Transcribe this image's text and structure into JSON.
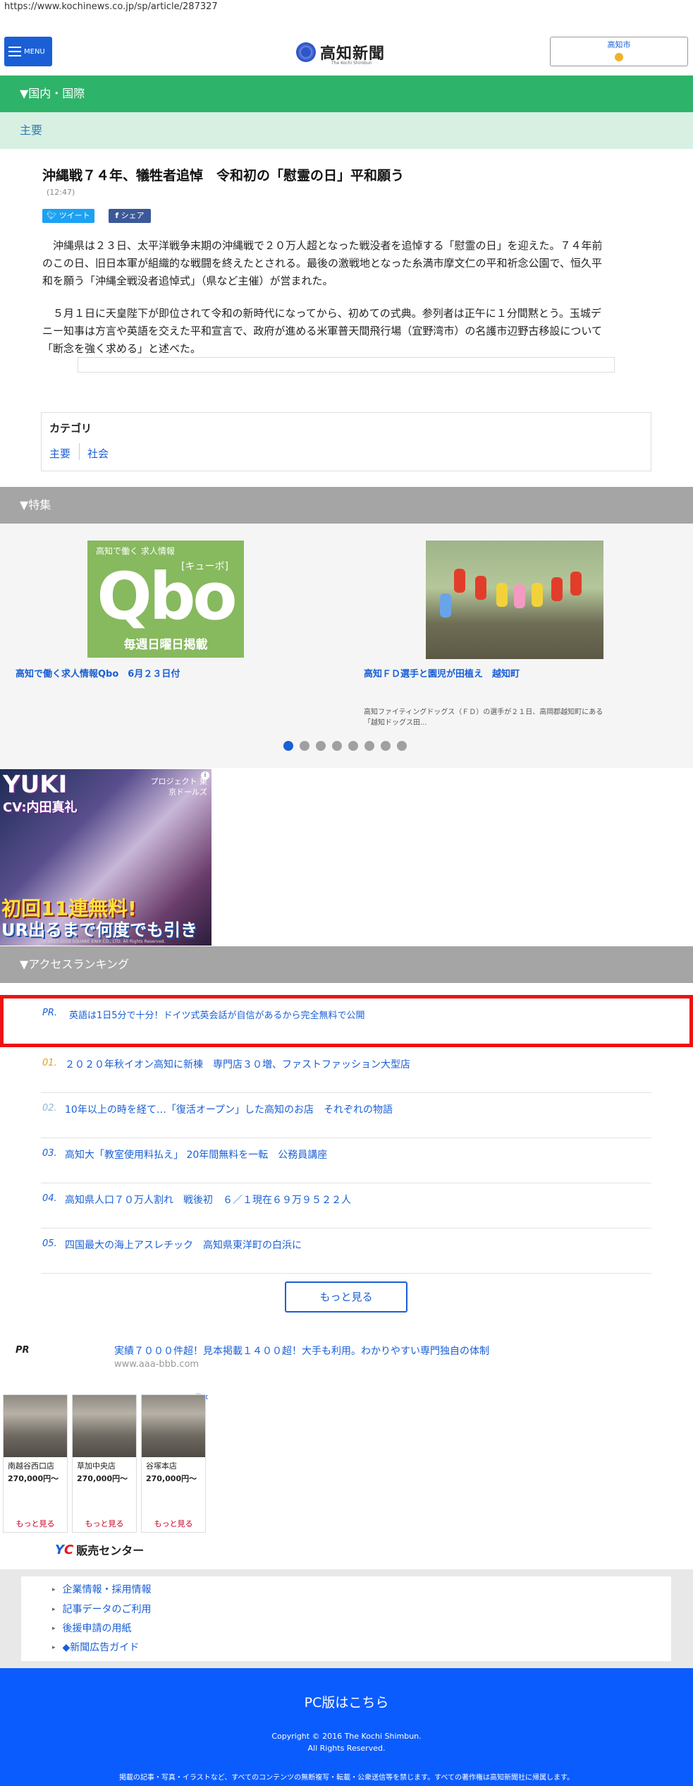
{
  "browser": {
    "url": "https://www.kochinews.co.jp/sp/article/287327"
  },
  "header": {
    "menu_label": "MENU",
    "logo_text": "高知新聞",
    "logo_sub": "The Kochi Shimbun",
    "weather_label": "高知市"
  },
  "section": {
    "title": "▼国内・国際",
    "sub": "主要"
  },
  "article": {
    "headline": "沖縄戦７４年、犠牲者追悼　令和初の「慰霊の日」平和願う",
    "time": "(12:47)",
    "tweet_label": "ツイート",
    "share_label": "シェア",
    "para1_line1": "沖縄県は２３日、太平洋戦争末期の沖縄戦で２０万人超となった戦没者を追悼する「慰霊の日」を迎えた。７４年前",
    "para1_line2": "のこの日、旧日本軍が組織的な戦闘を終えたとされる。最後の激戦地となった糸満市摩文仁の平和祈念公園で、恒久平",
    "para1_line3": "和を願う「沖縄全戦没者追悼式」（県など主催）が営まれた。",
    "para2_line1": "５月１日に天皇陛下が即位されて令和の新時代になってから、初めての式典。参列者は正午に１分間黙とう。玉城デ",
    "para2_line2": "ニー知事は方言や英語を交えた平和宣言で、政府が進める米軍普天間飛行場（宜野湾市）の名護市辺野古移設について",
    "para2_line3": "「断念を強く求める」と述べた。"
  },
  "category": {
    "title": "カテゴリ",
    "items": [
      "主要",
      "社会"
    ]
  },
  "features": {
    "title": "▼特集",
    "qbo": {
      "top": "高知で働く 求人情報",
      "kana": "[キューボ]",
      "logo": "Qbo",
      "bottom": "毎週日曜日掲載"
    },
    "items": [
      {
        "caption": "高知で働く求人情報Qbo　6月２３日付"
      },
      {
        "caption": "高知ＦＤ選手と園児が田植え　越知町",
        "desc": "高知ファイティングドッグス（ＦＤ）の選手が２１日、高岡郡越知町にある「越知ドッグス田..."
      }
    ]
  },
  "game_ad": {
    "title": "YUKI",
    "cv": "CV:内田真礼",
    "project": "プロジェクト 東京ドールズ",
    "free": "初回11連無料!",
    "redo": "UR出るまで何度でも引き直せる!",
    "copyright": "© 2017-2019 SQUARE ENIX CO., LTD. All Rights Reserved."
  },
  "ranking": {
    "title": "▼アクセスランキング",
    "pr": {
      "num": "PR.",
      "text": "英語は1日5分で十分！ドイツ式英会話が自信があるから完全無料で公開"
    },
    "items": [
      {
        "num": "01.",
        "text": "２０２０年秋イオン高知に新棟　専門店３０増、ファストファッション大型店"
      },
      {
        "num": "02.",
        "text": "10年以上の時を経て…「復活オープン」した高知のお店　それぞれの物語"
      },
      {
        "num": "03.",
        "text": "高知大「教室使用料払え」 20年間無料を一転　公務員講座"
      },
      {
        "num": "04.",
        "text": "高知県人口７０万人割れ　戦後初　６／１現在６９万９５２２人"
      },
      {
        "num": "05.",
        "text": "四国最大の海上アスレチック　高知県東洋町の白浜に"
      }
    ],
    "more_label": "もっと見る",
    "colors": {
      "gold": "#e0a020",
      "silver": "#8fb8d8",
      "default": "#1a5fd6"
    }
  },
  "pr2": {
    "label": "PR",
    "link": "実績７０００件超！見本掲載１４００超！大手も利用。わかりやすい専門独自の体制",
    "url": "www.aaa-bbb.com"
  },
  "shop_ad": {
    "shops": [
      {
        "name": "南越谷西口店",
        "price": "270,000円〜",
        "more": "もっと見る"
      },
      {
        "name": "草加中央店",
        "price": "270,000円〜",
        "more": "もっと見る"
      },
      {
        "name": "谷塚本店",
        "price": "270,000円〜",
        "more": "もっと見る"
      }
    ],
    "brand": "販売センター",
    "brand_mark": "YC"
  },
  "footer_links": [
    "企業情報・採用情報",
    "記事データのご利用",
    "後援申請の用紙",
    "◆新聞広告ガイド"
  ],
  "footer": {
    "pc_link": "PC版はこちら",
    "copyright1": "Copyright © 2016 The Kochi Shimbun.",
    "copyright2": "All Rights Reserved.",
    "notice": "掲載の記事・写真・イラストなど、すべてのコンテンツの無断複写・転載・公衆送信等を禁じます。すべての著作権は高知新聞社に帰属します。"
  }
}
